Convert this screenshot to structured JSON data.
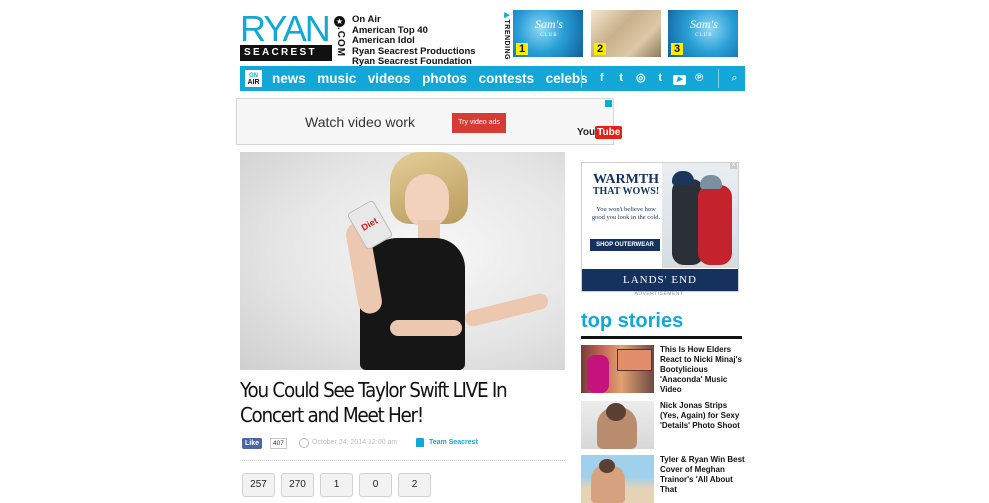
{
  "logo": {
    "ryan": "RYAN",
    "seacrest": "SEACREST",
    "dotcom": ".COM"
  },
  "header_links": [
    "On Air",
    "American Top 40",
    "American Idol",
    "Ryan Seacrest Productions",
    "Ryan Seacrest Foundation"
  ],
  "trending": {
    "label": "TRENDING",
    "items": [
      {
        "num": "1",
        "brand": "Sam's",
        "brand_sub": "CLUB"
      },
      {
        "num": "2"
      },
      {
        "num": "3",
        "brand": "Sam's",
        "brand_sub": "CLUB"
      }
    ]
  },
  "nav": {
    "onair_top": "ON",
    "onair_bottom": "AIR",
    "items": [
      "news",
      "music",
      "videos",
      "photos",
      "contests",
      "celebs"
    ],
    "social": [
      "f",
      "t",
      "◎",
      "t",
      "▶",
      "℗"
    ],
    "search": "⌕"
  },
  "ad_banner": {
    "text": "Watch video work",
    "button": "Try video ads",
    "brand_prefix": "You",
    "brand_suffix": "Tube"
  },
  "article": {
    "title": "You Could See Taylor Swift LIVE In Concert and Meet Her!",
    "can_text": "Diet",
    "fb_like": "Like",
    "fb_count": "407",
    "date": "October 24, 2014 12:00 am",
    "author": "Team Seacrest",
    "shares": [
      "257",
      "270",
      "1",
      "0",
      "2"
    ]
  },
  "side_ad": {
    "headline_1": "WARMTH",
    "headline_2": "THAT WOWS!",
    "sub": "You won't believe how good you look in the cold.",
    "cta": "SHOP OUTERWEAR",
    "brand": "LANDS' END",
    "label": "ADVERTISEMENT",
    "close": "x"
  },
  "top_stories": {
    "title": "top stories",
    "items": [
      {
        "text": "This Is How Elders React to Nicki Minaj's Bootylicious 'Anaconda' Music Video"
      },
      {
        "text": "Nick Jonas Strips (Yes, Again) for Sexy 'Details' Photo Shoot"
      },
      {
        "text": "Tyler & Ryan Win Best Cover of Meghan Trainor's 'All About That"
      }
    ]
  },
  "colors": {
    "accent": "#12a7d6",
    "nav_bg": "#12a7d6",
    "trend_badge": "#ffec00",
    "ad_button": "#d63b35",
    "lands_end_navy": "#15325f"
  }
}
